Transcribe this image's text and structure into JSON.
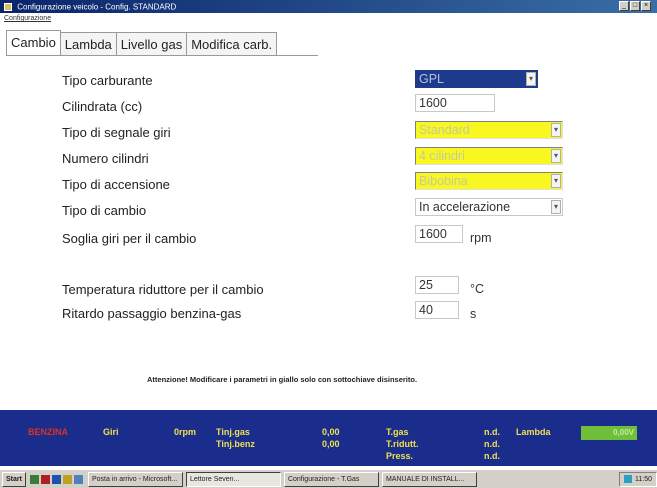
{
  "window": {
    "title": "Configurazione veicolo - Config. STANDARD",
    "buttons": [
      "_",
      "□",
      "×"
    ]
  },
  "menu": {
    "item": "Configurazione"
  },
  "tabs": [
    "Cambio",
    "Lambda",
    "Livello gas",
    "Modifica carb."
  ],
  "active_tab": "Cambio",
  "form": {
    "tipo_carburante": {
      "label": "Tipo carburante",
      "value": "GPL"
    },
    "cilindrata": {
      "label": "Cilindrata (cc)",
      "value": "1600"
    },
    "segnale_giri": {
      "label": "Tipo di segnale giri",
      "value": "Standard"
    },
    "numero_cilindri": {
      "label": "Numero cilindri",
      "value": "4 cilindri"
    },
    "accensione": {
      "label": "Tipo di accensione",
      "value": "Bibobina"
    },
    "cambio": {
      "label": "Tipo di cambio",
      "value": "In accelerazione"
    },
    "soglia_giri": {
      "label": "Soglia giri per il cambio",
      "value": "1600",
      "unit": "rpm"
    },
    "temperatura": {
      "label": "Temperatura riduttore per il cambio",
      "value": "25",
      "unit": "°C"
    },
    "ritardo": {
      "label": "Ritardo passaggio benzina-gas",
      "value": "40",
      "unit": "s"
    }
  },
  "warning": "Attenzione! Modificare i parametri in giallo solo con sottochiave disinserito.",
  "status": {
    "fuel": "BENZINA",
    "giri_label": "Giri",
    "giri_value": "0rpm",
    "tinj_gas_label": "Tinj.gas",
    "tinj_gas_value": "0,00",
    "tinj_benz_label": "Tinj.benz",
    "tinj_benz_value": "0,00",
    "tgas_label": "T.gas",
    "tgas_value": "n.d.",
    "trid_label": "T.ridutt.",
    "trid_value": "n.d.",
    "press_label": "Press.",
    "press_value": "n.d.",
    "lambda_label": "Lambda",
    "lambda_value": "0,00V"
  },
  "taskbar": {
    "start": "Start",
    "tasks": [
      "Posta in arrivo - Microsoft...",
      "Lettore Seven...",
      "Configurazione - T.Gas",
      "MANUALE DI INSTALL..."
    ],
    "clock": "11:50"
  }
}
